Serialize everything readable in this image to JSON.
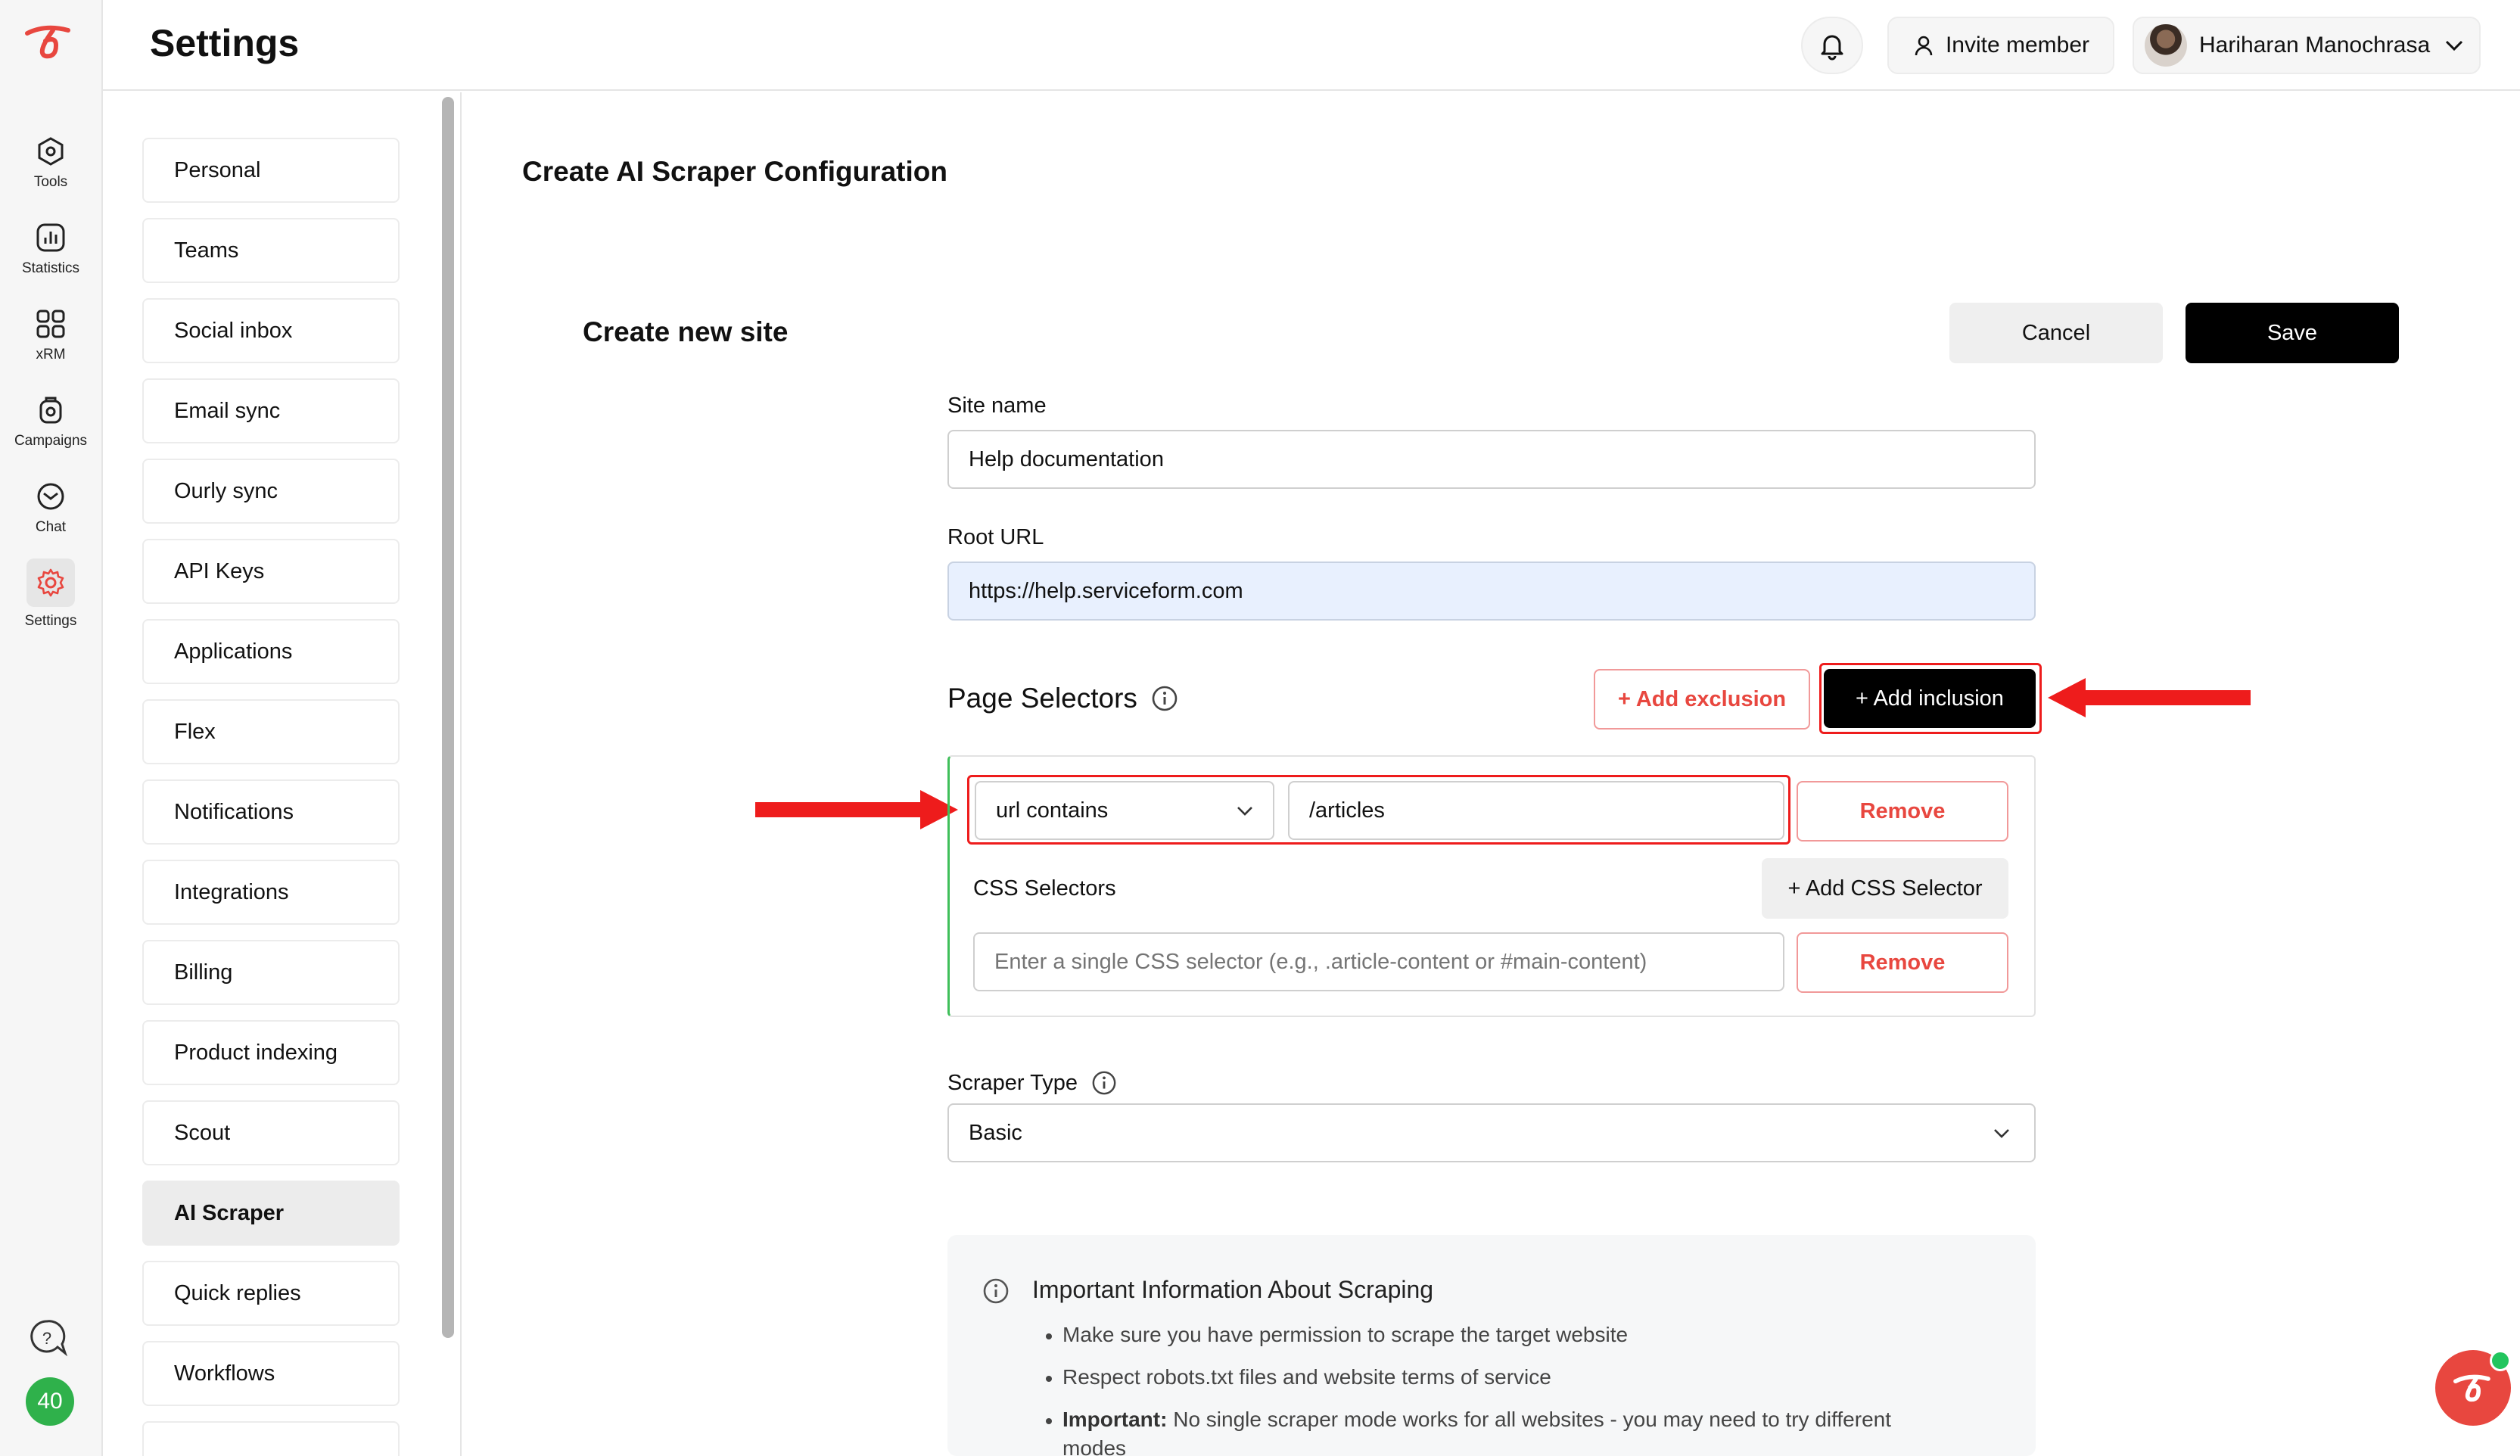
{
  "rail": {
    "items": [
      {
        "label": "Tools",
        "icon": "hexagon-tools-icon"
      },
      {
        "label": "Statistics",
        "icon": "statistics-icon"
      },
      {
        "label": "xRM",
        "icon": "grid-icon"
      },
      {
        "label": "Campaigns",
        "icon": "campaigns-icon"
      },
      {
        "label": "Chat",
        "icon": "chat-icon"
      },
      {
        "label": "Settings",
        "icon": "gear-icon",
        "active": true
      }
    ],
    "badge_count": "40"
  },
  "header": {
    "title": "Settings",
    "invite_label": "Invite member",
    "user_name": "Hariharan Manochrasa"
  },
  "settings_nav": {
    "items": [
      "Personal",
      "Teams",
      "Social inbox",
      "Email sync",
      "Ourly sync",
      "API Keys",
      "Applications",
      "Flex",
      "Notifications",
      "Integrations",
      "Billing",
      "Product indexing",
      "Scout",
      "AI Scraper",
      "Quick replies",
      "Workflows"
    ],
    "active": "AI Scraper"
  },
  "main": {
    "title": "Create AI Scraper Configuration",
    "subtitle": "Create new site",
    "cancel_label": "Cancel",
    "save_label": "Save",
    "site_name": {
      "label": "Site name",
      "value": "Help documentation"
    },
    "root_url": {
      "label": "Root URL",
      "value": "https://help.serviceform.com"
    },
    "page_selectors": {
      "title": "Page Selectors",
      "add_exclusion_label": "+ Add exclusion",
      "add_inclusion_label": "+ Add inclusion",
      "rule_type": "url contains",
      "rule_value": "/articles",
      "remove_label": "Remove",
      "css_selectors_label": "CSS Selectors",
      "add_css_label": "+ Add CSS Selector",
      "css_placeholder": "Enter a single CSS selector (e.g., .article-content or #main-content)",
      "css_remove_label": "Remove"
    },
    "scraper_type": {
      "label": "Scraper Type",
      "value": "Basic"
    },
    "info": {
      "title": "Important Information About Scraping",
      "bullets": [
        "Make sure you have permission to scrape the target website",
        "Respect robots.txt files and website terms of service"
      ],
      "important_prefix": "Important:",
      "important_text": " No single scraper mode works for all websites - you may need to try different",
      "important_text_cont": "modes"
    }
  },
  "colors": {
    "accent_red": "#e8473f",
    "annotation_red": "#ee1c1c",
    "badge_green": "#2fb14b",
    "inclusion_border": "#3fbf5a"
  }
}
